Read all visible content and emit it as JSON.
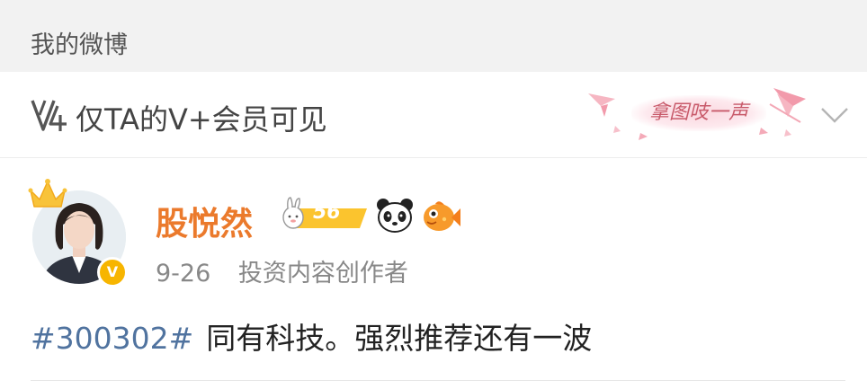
{
  "section": {
    "title": "我的微博"
  },
  "visibility": {
    "label": "仅TA的V+会员可见",
    "stamp_text": "拿图吱一声"
  },
  "post": {
    "username": "股悦然",
    "level_badge": "56",
    "date": "9-26",
    "source": "投资内容创作者",
    "hashtag": "#300302#",
    "text": "同有科技。强烈推荐还有一波",
    "verify_mark": "V"
  },
  "icons": {
    "vplus": "vplus-icon",
    "crown": "crown-icon",
    "panda": "panda-icon",
    "fish": "fish-icon",
    "chevron": "chevron-down-icon"
  },
  "colors": {
    "username": "#eb7a2c",
    "hashtag": "#50739f",
    "verify": "#f7b500",
    "header_bg": "#f2f2f2"
  }
}
